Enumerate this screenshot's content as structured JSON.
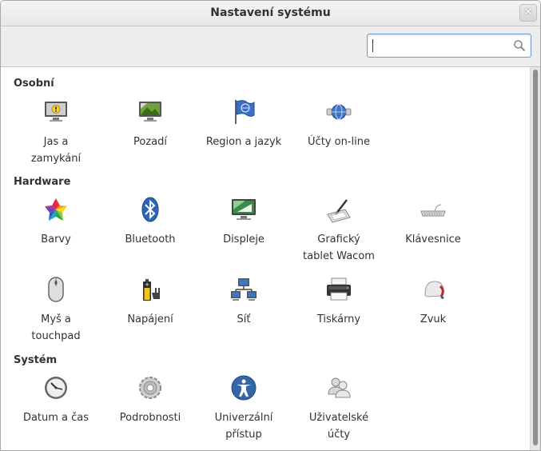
{
  "window": {
    "title": "Nastavení systému"
  },
  "search": {
    "value": "",
    "placeholder": ""
  },
  "sections": [
    {
      "title": "Osobní",
      "items": [
        "Jas a zamykání",
        "Pozadí",
        "Region a jazyk",
        "Účty on-line"
      ]
    },
    {
      "title": "Hardware",
      "items": [
        "Barvy",
        "Bluetooth",
        "Displeje",
        "Grafický tablet Wacom",
        "Klávesnice",
        "Myš a touchpad",
        "Napájení",
        "Síť",
        "Tiskárny",
        "Zvuk"
      ]
    },
    {
      "title": "Systém",
      "items": [
        "Datum a čas",
        "Podrobnosti",
        "Univerzální přístup",
        "Uživatelské účty"
      ]
    }
  ],
  "labels": {
    "jas1": "Jas a",
    "jas2": "zamykání",
    "pozadi": "Pozadí",
    "region": "Region a jazyk",
    "ucty": "Účty on-line",
    "barvy": "Barvy",
    "bluetooth": "Bluetooth",
    "displeje": "Displeje",
    "wacom1": "Grafický",
    "wacom2": "tablet Wacom",
    "klavesnice": "Klávesnice",
    "mys1": "Myš a",
    "mys2": "touchpad",
    "napajeni": "Napájení",
    "sit": "Síť",
    "tiskarny": "Tiskárny",
    "zvuk": "Zvuk",
    "datum": "Datum a čas",
    "podrobnosti": "Podrobnosti",
    "univ1": "Univerzální",
    "univ2": "přístup",
    "uziv1": "Uživatelské",
    "uziv2": "účty"
  },
  "icons": {
    "close": "close-icon",
    "search": "search-icon",
    "brightness": "brightness-lock-icon",
    "background": "background-icon",
    "region": "region-flag-icon",
    "online": "online-accounts-icon",
    "color": "color-icon",
    "bluetooth": "bluetooth-icon",
    "display": "display-icon",
    "wacom": "wacom-tablet-icon",
    "keyboard": "keyboard-icon",
    "mouse": "mouse-icon",
    "power": "power-icon",
    "network": "network-icon",
    "printer": "printer-icon",
    "sound": "sound-icon",
    "clock": "clock-icon",
    "details": "details-gear-icon",
    "accessibility": "accessibility-icon",
    "users": "users-icon"
  },
  "colors": {
    "accent": "#3465a4",
    "titlebar": "#ededed",
    "text": "#2e3436"
  }
}
